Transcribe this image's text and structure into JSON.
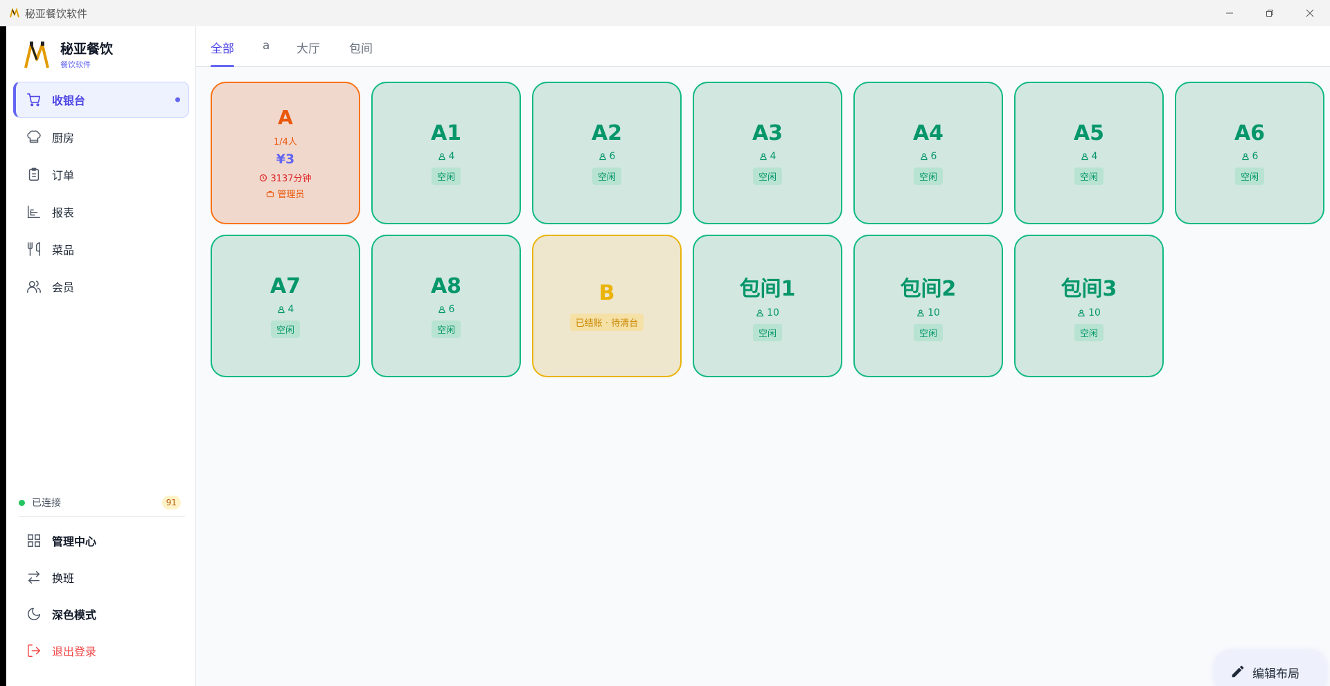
{
  "window": {
    "title": "秘亚餐饮软件"
  },
  "brand": {
    "title": "秘亚餐饮",
    "subtitle": "餐饮软件"
  },
  "nav": {
    "items": [
      {
        "label": "收银台",
        "icon": "cart-icon",
        "active": true
      },
      {
        "label": "厨房",
        "icon": "chef-hat-icon"
      },
      {
        "label": "订单",
        "icon": "clipboard-icon"
      },
      {
        "label": "报表",
        "icon": "bar-chart-icon"
      },
      {
        "label": "菜品",
        "icon": "utensils-icon"
      },
      {
        "label": "会员",
        "icon": "users-icon"
      }
    ]
  },
  "connection": {
    "label": "已连接",
    "count": "91"
  },
  "bottom_nav": {
    "items": [
      {
        "label": "管理中心",
        "icon": "grid-icon"
      },
      {
        "label": "换班",
        "icon": "swap-icon"
      },
      {
        "label": "深色模式",
        "icon": "moon-icon"
      },
      {
        "label": "退出登录",
        "icon": "logout-icon"
      }
    ]
  },
  "tabs": [
    {
      "label": "全部",
      "active": true
    },
    {
      "label": "a"
    },
    {
      "label": "大厅"
    },
    {
      "label": "包间"
    }
  ],
  "tables": [
    {
      "name": "A",
      "state": "occupied",
      "people": "1/4人",
      "amount": "¥3",
      "time": "3137分钟",
      "staff": "管理员"
    },
    {
      "name": "A1",
      "state": "free",
      "seats": "4",
      "status": "空闲"
    },
    {
      "name": "A2",
      "state": "free",
      "seats": "6",
      "status": "空闲"
    },
    {
      "name": "A3",
      "state": "free",
      "seats": "4",
      "status": "空闲"
    },
    {
      "name": "A4",
      "state": "free",
      "seats": "6",
      "status": "空闲"
    },
    {
      "name": "A5",
      "state": "free",
      "seats": "4",
      "status": "空闲"
    },
    {
      "name": "A6",
      "state": "free",
      "seats": "6",
      "status": "空闲"
    },
    {
      "name": "A7",
      "state": "free",
      "seats": "4",
      "status": "空闲"
    },
    {
      "name": "A8",
      "state": "free",
      "seats": "6",
      "status": "空闲"
    },
    {
      "name": "B",
      "state": "cleaning",
      "status": "已结账 · 待清台"
    },
    {
      "name": "包间1",
      "state": "free",
      "seats": "10",
      "status": "空闲"
    },
    {
      "name": "包间2",
      "state": "free",
      "seats": "10",
      "status": "空闲"
    },
    {
      "name": "包间3",
      "state": "free",
      "seats": "10",
      "status": "空闲"
    }
  ],
  "fab": {
    "label": "编辑布局"
  },
  "colors": {
    "accent": "#6366f1",
    "free": "#10b981",
    "occupied": "#f97316",
    "cleaning": "#eab308",
    "danger": "#ef4444"
  }
}
